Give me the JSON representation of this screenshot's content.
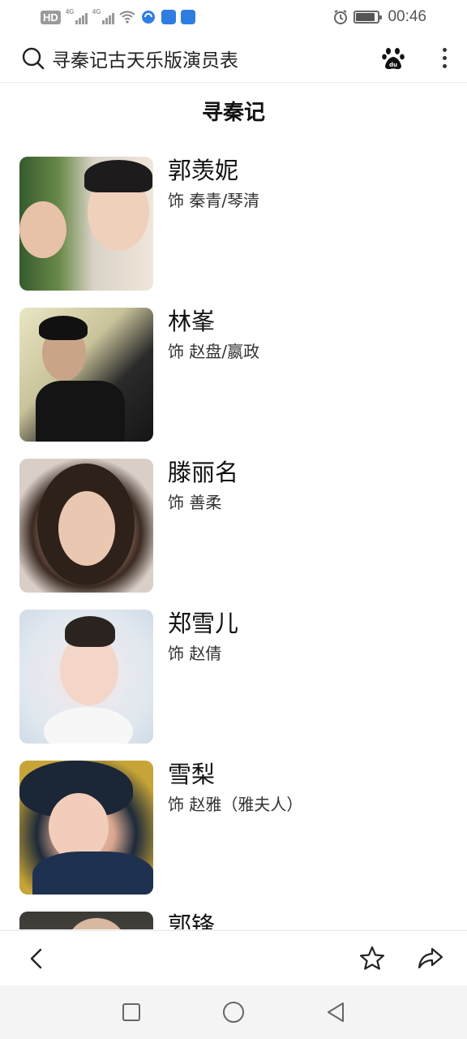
{
  "status_bar": {
    "hd_label": "HD",
    "network_1": "4G",
    "network_2": "4G",
    "time": "00:46",
    "battery_level": 0.85
  },
  "search": {
    "query": "寻秦记古天乐版演员表"
  },
  "page": {
    "title": "寻秦记"
  },
  "cast": [
    {
      "name": "郭羡妮",
      "role": "饰 秦青/琴清"
    },
    {
      "name": "林峯",
      "role": "饰 赵盘/嬴政"
    },
    {
      "name": "滕丽名",
      "role": "饰 善柔"
    },
    {
      "name": "郑雪儿",
      "role": "饰 赵倩"
    },
    {
      "name": "雪梨",
      "role": "饰 赵雅（雅夫人）"
    },
    {
      "name": "郭锋",
      "role": ""
    }
  ],
  "icons": {
    "search": "search-icon",
    "baidu": "baidu-paw-icon",
    "more": "more-vertical-icon",
    "back": "chevron-left-icon",
    "favorite": "star-icon",
    "share": "share-icon",
    "recents": "square-icon",
    "home": "circle-icon",
    "nav_back": "triangle-back-icon"
  },
  "colors": {
    "text": "#111111",
    "subtext": "#333333",
    "nav_bg": "#f4f4f4",
    "divider": "#ececec"
  }
}
